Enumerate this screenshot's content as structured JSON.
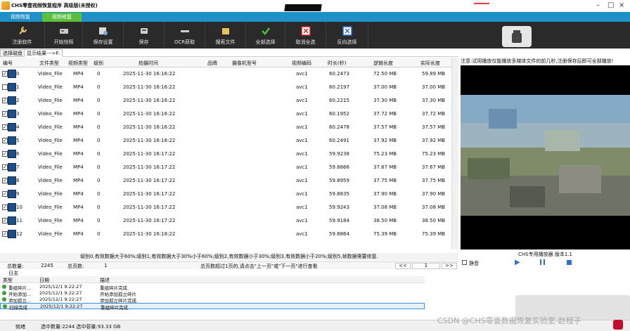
{
  "window": {
    "title": "CHS零壹视频恢复程序 高级版(未授权)"
  },
  "tabs": [
    {
      "label": "视频恢复"
    },
    {
      "label": "视频修复"
    }
  ],
  "toolbar": {
    "items": [
      {
        "label": "注册软件",
        "icon": "wrench-icon"
      },
      {
        "label": "开始快照",
        "icon": "disk-icon"
      },
      {
        "label": "保存设置",
        "icon": "disk-settings-icon"
      },
      {
        "label": "保存",
        "icon": "save-icon"
      },
      {
        "label": "OCR获取",
        "icon": "scan-icon"
      },
      {
        "label": "搜索文件",
        "icon": "folder-search-icon"
      },
      {
        "label": "全部选择",
        "icon": "check-icon"
      },
      {
        "label": "取消全选",
        "icon": "x-box-icon"
      },
      {
        "label": "反向选择",
        "icon": "invert-icon"
      }
    ]
  },
  "path": {
    "tab1": "选择磁盘",
    "tab2": "显示结果--->F:"
  },
  "table": {
    "headers": [
      "编号",
      "文件类型",
      "视频类型",
      "级别",
      "拍摄时间",
      "品牌",
      "摄像机型号",
      "视频编码",
      "时长(秒)",
      "逻辑长度",
      "实际长度"
    ],
    "rows": [
      {
        "checked": true,
        "id": "0",
        "ftype": "Video_File",
        "vtype": "MP4",
        "level": "0",
        "time": "2025-11-30 16:16:22",
        "codec": "avc1",
        "dur": "60.2473",
        "logical": "72.50 MB",
        "actual": "59.89 MB"
      },
      {
        "checked": false,
        "id": "1",
        "ftype": "Video_File",
        "vtype": "MP4",
        "level": "0",
        "time": "2025-11-30 16:16:22",
        "codec": "avc1",
        "dur": "60.2197",
        "logical": "37.00 MB",
        "actual": "37.00 MB"
      },
      {
        "checked": true,
        "id": "2",
        "ftype": "Video_File",
        "vtype": "MP4",
        "level": "0",
        "time": "2025-11-30 16:16:22",
        "codec": "avc1",
        "dur": "60.2215",
        "logical": "37.30 MB",
        "actual": "37.30 MB"
      },
      {
        "checked": true,
        "id": "3",
        "ftype": "Video_File",
        "vtype": "MP4",
        "level": "0",
        "time": "2025-11-30 16:16:22",
        "codec": "avc1",
        "dur": "60.1952",
        "logical": "37.72 MB",
        "actual": "37.72 MB"
      },
      {
        "checked": true,
        "id": "4",
        "ftype": "Video_File",
        "vtype": "MP4",
        "level": "0",
        "time": "2025-11-30 16:16:22",
        "codec": "avc1",
        "dur": "60.2478",
        "logical": "37.57 MB",
        "actual": "37.57 MB"
      },
      {
        "checked": true,
        "id": "5",
        "ftype": "Video_File",
        "vtype": "MP4",
        "level": "0",
        "time": "2025-11-30 16:16:22",
        "codec": "avc1",
        "dur": "60.2491",
        "logical": "37.92 MB",
        "actual": "37.92 MB"
      },
      {
        "checked": true,
        "id": "6",
        "ftype": "Video_File",
        "vtype": "MP4",
        "level": "0",
        "time": "2025-11-30 16:17:22",
        "codec": "avc1",
        "dur": "59.9238",
        "logical": "75.23 MB",
        "actual": "75.23 MB"
      },
      {
        "checked": true,
        "id": "7",
        "ftype": "Video_File",
        "vtype": "MP4",
        "level": "0",
        "time": "2025-11-30 16:17:22",
        "codec": "avc1",
        "dur": "59.8866",
        "logical": "37.67 MB",
        "actual": "37.67 MB"
      },
      {
        "checked": true,
        "id": "8",
        "ftype": "Video_File",
        "vtype": "MP4",
        "level": "0",
        "time": "2025-11-30 16:17:22",
        "codec": "avc1",
        "dur": "59.8959",
        "logical": "37.75 MB",
        "actual": "37.75 MB"
      },
      {
        "checked": true,
        "id": "9",
        "ftype": "Video_File",
        "vtype": "MP4",
        "level": "0",
        "time": "2025-11-30 16:17:22",
        "codec": "avc1",
        "dur": "59.8835",
        "logical": "37.90 MB",
        "actual": "37.90 MB"
      },
      {
        "checked": true,
        "id": "10",
        "ftype": "Video_File",
        "vtype": "MP4",
        "level": "0",
        "time": "2025-11-30 16:17:22",
        "codec": "avc1",
        "dur": "59.9243",
        "logical": "37.08 MB",
        "actual": "37.08 MB"
      },
      {
        "checked": true,
        "id": "11",
        "ftype": "Video_File",
        "vtype": "MP4",
        "level": "0",
        "time": "2025-11-30 16:17:22",
        "codec": "avc1",
        "dur": "59.9184",
        "logical": "38.50 MB",
        "actual": "38.50 MB"
      },
      {
        "checked": true,
        "id": "12",
        "ftype": "Video_File",
        "vtype": "MP4",
        "level": "0",
        "time": "2025-11-30 16:18:22",
        "codec": "avc1",
        "dur": "59.8864",
        "logical": "75.39 MB",
        "actual": "75.39 MB"
      }
    ]
  },
  "level_note": "级别0,有效数据大于60%;级别1,有效数据大于30%小于60%;级别2,有效数据小于30%;级别3,有效数据小于20%;级别5,帧数据需要修复.",
  "counts": {
    "total_label": "总数量:",
    "total_value": "2245",
    "pages_label": "总页数:",
    "pages_value": "1",
    "page_hint": "总页数超过1页的,请点击\"上一页\"或\"下一页\"进行查看",
    "prev": "<<",
    "page_value": "1",
    "next": ">>"
  },
  "preview": {
    "notice": "注意:试用播放仅能播放多媒体文件的前几秒,注册保存后即可全部播放!",
    "player_label": "CHS专用播放器 版本1.1",
    "mute_label": "静音"
  },
  "log": {
    "title": "日志",
    "headers": [
      "类型",
      "日期",
      "描述"
    ],
    "rows": [
      {
        "type": "重组碎片...",
        "date": "2025/12/1 9:22:27",
        "desc": "重组碎片完成."
      },
      {
        "type": "开始添加...",
        "date": "2025/12/1 9:22:27",
        "desc": "开始添加孤立碎片"
      },
      {
        "type": "添加孤立...",
        "date": "2025/12/1 9:22:27",
        "desc": "添加孤立碎片完成."
      },
      {
        "type": "扫描完成",
        "date": "2025/12/1 9:22:27",
        "desc": "重组碎片完成."
      }
    ]
  },
  "status": {
    "ready": "就绪",
    "selection": "选中数量:2244 选中容量:93.33 GB"
  },
  "watermark": "CSDN @CHS零壹数据恢复实验室-赵程子",
  "colors": {
    "tab_bar": "#1e8fc7",
    "tab_active": "#5bbf3a",
    "toolbar_bg": "#2a2a2a"
  }
}
